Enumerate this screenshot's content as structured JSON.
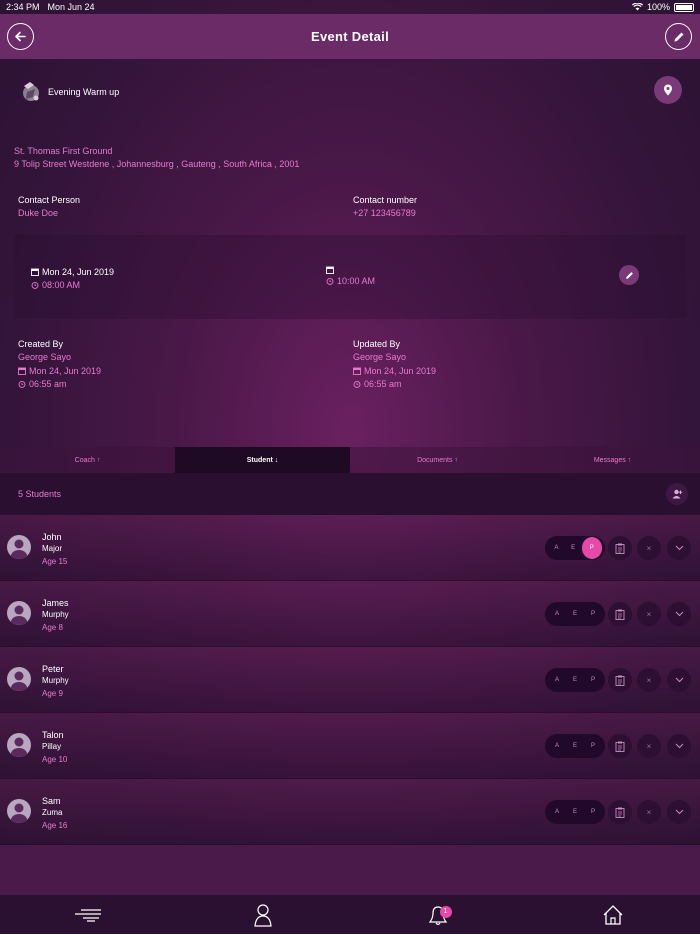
{
  "status_bar": {
    "time": "2:34 PM",
    "date": "Mon Jun 24",
    "battery": "100%"
  },
  "header": {
    "title": "Event Detail"
  },
  "event": {
    "name": "Evening Warm up",
    "venue": "St. Thomas First Ground",
    "address": "9 Tolip Street Westdene , Johannesburg , Gauteng , South Africa , 2001"
  },
  "contact": {
    "person_label": "Contact Person",
    "person": "Duke Doe",
    "number_label": "Contact number",
    "number": "+27 123456789"
  },
  "schedule": {
    "start_date": "Mon 24, Jun 2019",
    "start_time": "08:00 AM",
    "end_date": "",
    "end_time": "10:00 AM"
  },
  "created": {
    "label": "Created By",
    "name": "George Sayo",
    "date": "Mon 24, Jun 2019",
    "time": "06:55 am"
  },
  "updated": {
    "label": "Updated By",
    "name": "George Sayo",
    "date": "Mon 24, Jun 2019",
    "time": "06:55 am"
  },
  "tabs": [
    {
      "label": "Coach ↑"
    },
    {
      "label": "Student ↓"
    },
    {
      "label": "Documents ↑"
    },
    {
      "label": "Messages ↑"
    }
  ],
  "active_tab": "Student ↓",
  "students": {
    "count_label": "5 Students",
    "attendance_labels": [
      "A",
      "E",
      "P"
    ],
    "close_glyph": "×",
    "list": [
      {
        "first": "John",
        "last": "Major",
        "age": "Age 15",
        "status": "P"
      },
      {
        "first": "James",
        "last": "Murphy",
        "age": "Age 8",
        "status": ""
      },
      {
        "first": "Peter",
        "last": "Murphy",
        "age": "Age 9",
        "status": ""
      },
      {
        "first": "Talon",
        "last": "Pillay",
        "age": "Age 10",
        "status": ""
      },
      {
        "first": "Sam",
        "last": "Zuma",
        "age": "Age 16",
        "status": ""
      }
    ]
  },
  "bottom_nav": {
    "items": [
      "menu-icon",
      "profile-icon",
      "bell-icon",
      "home-icon"
    ],
    "notifications_badge": "1"
  },
  "colors": {
    "accent": "#e64aa6",
    "pink_text": "#e77bd0",
    "header": "#6a2b66",
    "background": "#2a1230"
  }
}
